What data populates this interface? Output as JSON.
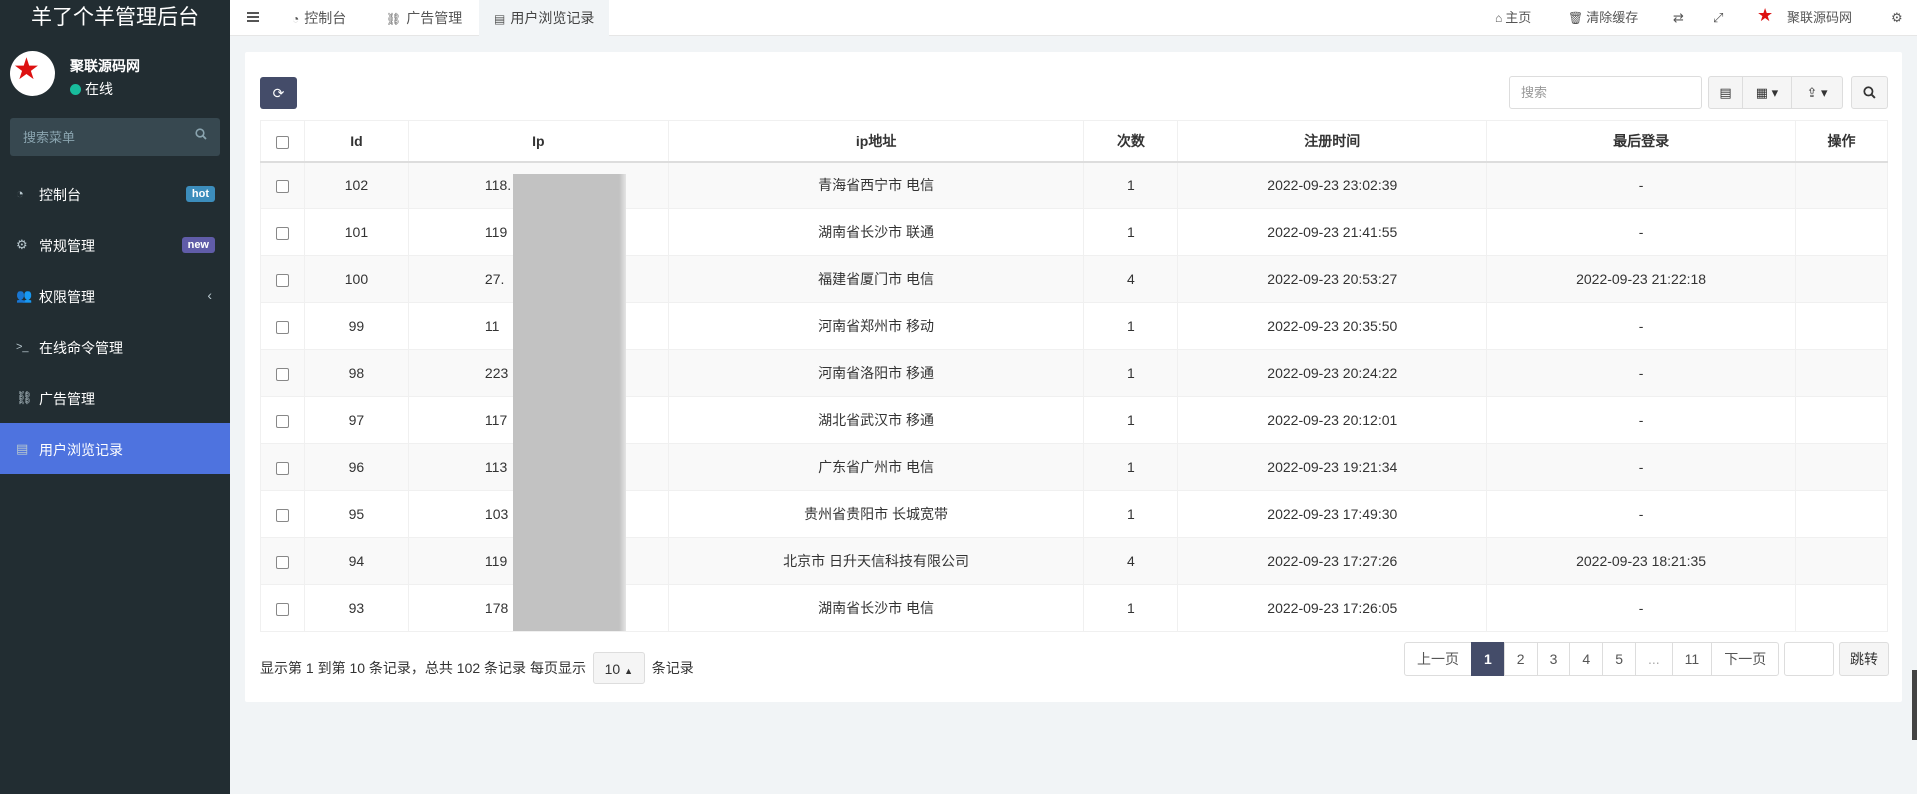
{
  "brand": "羊了个羊管理后台",
  "user": {
    "name": "聚联源码网",
    "status": "在线"
  },
  "sidebar_search": {
    "placeholder": "搜索菜单"
  },
  "menu": [
    {
      "label": "控制台",
      "icon": "dashboard-icon",
      "badge": "hot",
      "badge_color": "#3c8dbc"
    },
    {
      "label": "常规管理",
      "icon": "cogs-icon",
      "badge": "new",
      "badge_color": "#605ca8"
    },
    {
      "label": "权限管理",
      "icon": "users-icon",
      "arrow": "‹"
    },
    {
      "label": "在线命令管理",
      "icon": "terminal-icon"
    },
    {
      "label": "广告管理",
      "icon": "link-icon"
    },
    {
      "label": "用户浏览记录",
      "icon": "id-card-icon",
      "active": true
    }
  ],
  "top_tabs": [
    {
      "label": "控制台",
      "icon": "dashboard-icon"
    },
    {
      "label": "广告管理",
      "icon": "link-icon"
    },
    {
      "label": "用户浏览记录",
      "icon": "id-card-icon",
      "active": true
    }
  ],
  "top_right": {
    "home": "主页",
    "clear_cache": "清除缓存",
    "site_name": "聚联源码网"
  },
  "toolbar": {
    "search_placeholder": "搜索"
  },
  "table": {
    "headers": [
      "Id",
      "Ip",
      "ip地址",
      "次数",
      "注册时间",
      "最后登录",
      "操作"
    ],
    "rows": [
      {
        "id": "102",
        "ip": "118.",
        "addr": "青海省西宁市 电信",
        "count": "1",
        "reg": "2022-09-23 23:02:39",
        "last": "-"
      },
      {
        "id": "101",
        "ip": "119",
        "addr": "湖南省长沙市 联通",
        "count": "1",
        "reg": "2022-09-23 21:41:55",
        "last": "-"
      },
      {
        "id": "100",
        "ip": "27.",
        "addr": "福建省厦门市 电信",
        "count": "4",
        "reg": "2022-09-23 20:53:27",
        "last": "2022-09-23 21:22:18"
      },
      {
        "id": "99",
        "ip": "11",
        "addr": "河南省郑州市 移动",
        "count": "1",
        "reg": "2022-09-23 20:35:50",
        "last": "-"
      },
      {
        "id": "98",
        "ip": "223",
        "addr": "河南省洛阳市 移通",
        "count": "1",
        "reg": "2022-09-23 20:24:22",
        "last": "-"
      },
      {
        "id": "97",
        "ip": "117",
        "addr": "湖北省武汉市 移通",
        "count": "1",
        "reg": "2022-09-23 20:12:01",
        "last": "-"
      },
      {
        "id": "96",
        "ip": "113",
        "addr": "广东省广州市 电信",
        "count": "1",
        "reg": "2022-09-23 19:21:34",
        "last": "-"
      },
      {
        "id": "95",
        "ip": "103",
        "addr": "贵州省贵阳市 长城宽带",
        "count": "1",
        "reg": "2022-09-23 17:49:30",
        "last": "-"
      },
      {
        "id": "94",
        "ip": "119",
        "addr": "北京市 日升天信科技有限公司",
        "count": "4",
        "reg": "2022-09-23 17:27:26",
        "last": "2022-09-23 18:21:35"
      },
      {
        "id": "93",
        "ip": "178",
        "addr": "湖南省长沙市 电信",
        "count": "1",
        "reg": "2022-09-23 17:26:05",
        "last": "-"
      }
    ]
  },
  "pager": {
    "info_prefix": "显示第 1 到第 10 条记录，总共 102 条记录 每页显示",
    "page_size": "10",
    "info_suffix": "条记录",
    "prev": "上一页",
    "pages": [
      "1",
      "2",
      "3",
      "4",
      "5",
      "...",
      "11"
    ],
    "next": "下一页",
    "jump": "跳转"
  }
}
